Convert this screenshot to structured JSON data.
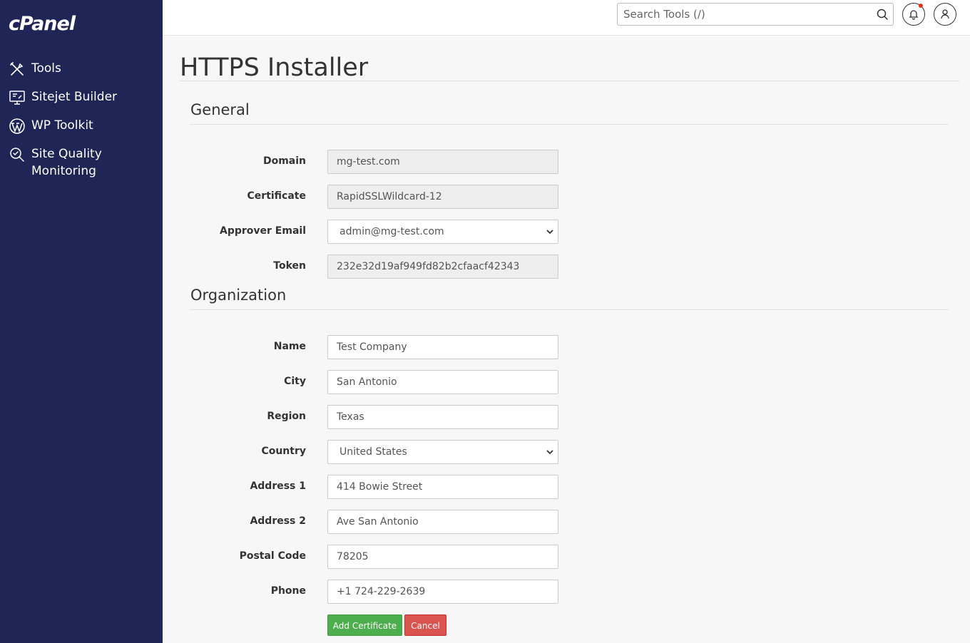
{
  "app": {
    "logo": "cPanel"
  },
  "sidebar": {
    "items": [
      {
        "label": "Tools",
        "icon": "tools-icon"
      },
      {
        "label": "Sitejet Builder",
        "icon": "monitor-icon"
      },
      {
        "label": "WP Toolkit",
        "icon": "wordpress-icon"
      },
      {
        "label": "Site Quality\nMonitoring",
        "icon": "magnifier-check-icon"
      }
    ]
  },
  "topbar": {
    "search_placeholder": "Search Tools (/)",
    "notifications_icon": "bell-icon",
    "user_icon": "user-icon"
  },
  "page": {
    "title": "HTTPS Installer"
  },
  "general": {
    "title": "General",
    "fields": {
      "domain": {
        "label": "Domain",
        "value": "mg-test.com"
      },
      "certificate": {
        "label": "Certificate",
        "value": "RapidSSLWildcard-12"
      },
      "approver_email": {
        "label": "Approver Email",
        "value": "admin@mg-test.com"
      },
      "token": {
        "label": "Token",
        "value": "232e32d19af949fd82b2cfaacf42343"
      }
    }
  },
  "organization": {
    "title": "Organization",
    "fields": {
      "name": {
        "label": "Name",
        "value": "Test Company"
      },
      "city": {
        "label": "City",
        "value": "San Antonio"
      },
      "region": {
        "label": "Region",
        "value": "Texas"
      },
      "country": {
        "label": "Country",
        "value": "United States"
      },
      "address1": {
        "label": "Address 1",
        "value": "414 Bowie Street"
      },
      "address2": {
        "label": "Address 2",
        "value": "Ave San Antonio"
      },
      "postal_code": {
        "label": "Postal Code",
        "value": "78205"
      },
      "phone": {
        "label": "Phone",
        "value": "+1 724-229-2639"
      }
    }
  },
  "actions": {
    "add_label": "Add Certificate",
    "cancel_label": "Cancel"
  },
  "colors": {
    "sidebar": "#1f2555",
    "add": "#4cae4c",
    "cancel": "#d9534f",
    "notification_dot": "#e0342b"
  }
}
